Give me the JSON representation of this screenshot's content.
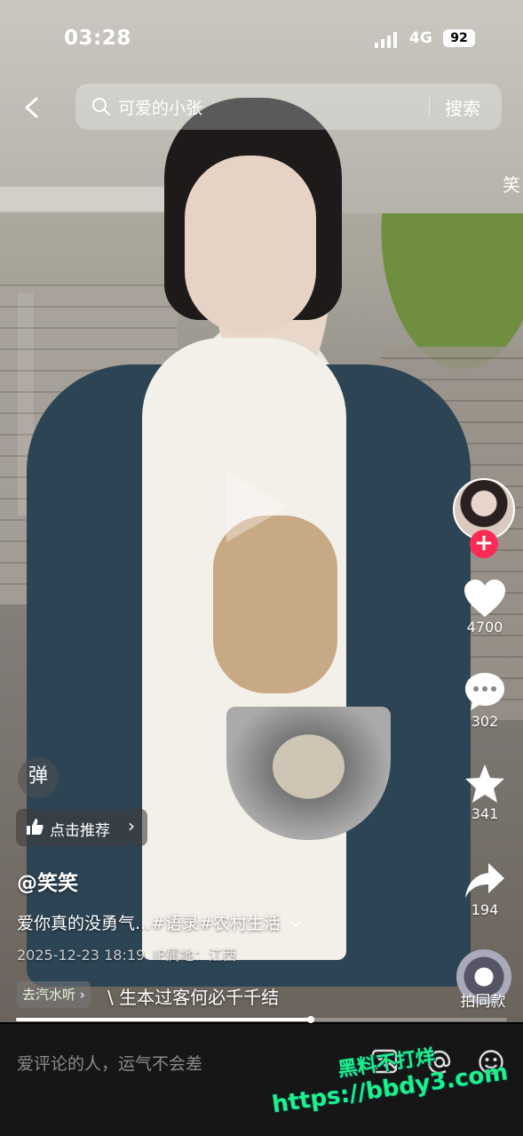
{
  "status_bar": {
    "time": "03:28",
    "network": "4G",
    "battery": "92"
  },
  "search": {
    "query": "可爱的小张",
    "button": "搜索"
  },
  "edge_text": "笑",
  "actions": {
    "likes": "4700",
    "comments": "302",
    "favorites": "341",
    "shares": "194",
    "same_style": "拍同款"
  },
  "danmu_label": "弹",
  "recommend": {
    "label": "点击推荐",
    "chevron": "›"
  },
  "post": {
    "author": "@笑笑",
    "caption": "爱你真的没勇气...#语录#农村生活",
    "date": "2025-12-23 18:19",
    "ip_label": "IP属地：江西",
    "music_chip": "去汽水听",
    "lyric": "\\ 生本过客何必千千结"
  },
  "progress": {
    "fraction": 0.6
  },
  "comment_bar": {
    "placeholder": "爱评论的人，运气不会差"
  },
  "watermark": {
    "line1": "黑料不打烊",
    "line2": "https://bbdy3.com"
  },
  "colors": {
    "accent": "#fe2c55",
    "watermark": "#1ef08a",
    "bottom_bar": "#161616"
  },
  "icons": [
    "back-icon",
    "search-icon",
    "heart-icon",
    "comment-icon",
    "star-icon",
    "share-icon",
    "image-icon",
    "at-icon",
    "emoji-icon",
    "thumb-icon"
  ]
}
